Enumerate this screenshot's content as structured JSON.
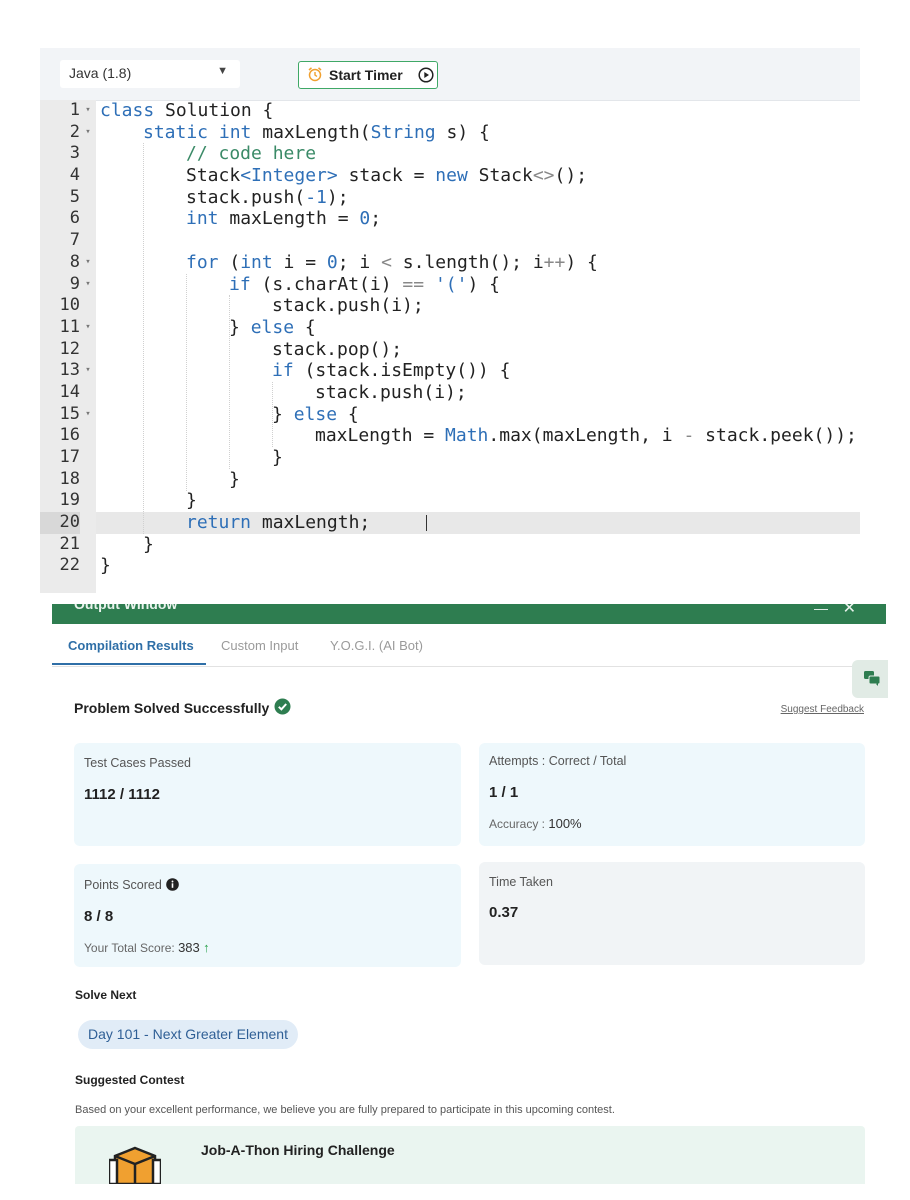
{
  "toolbar": {
    "language": "Java (1.8)",
    "timer_label": "Start Timer"
  },
  "editor": {
    "active_line": 20,
    "lines": [
      {
        "n": "1",
        "fold": true,
        "indent": 0,
        "tokens": [
          {
            "t": "class",
            "c": "kw"
          },
          {
            "t": " Solution {",
            "c": "pl"
          }
        ]
      },
      {
        "n": "2",
        "fold": true,
        "indent": 1,
        "tokens": [
          {
            "t": "static",
            "c": "kw"
          },
          {
            "t": " ",
            "c": "pl"
          },
          {
            "t": "int",
            "c": "kw"
          },
          {
            "t": " maxLength(",
            "c": "pl"
          },
          {
            "t": "String",
            "c": "kw"
          },
          {
            "t": " s) {",
            "c": "pl"
          }
        ]
      },
      {
        "n": "3",
        "fold": false,
        "indent": 2,
        "tokens": [
          {
            "t": "// code here",
            "c": "cm"
          }
        ]
      },
      {
        "n": "4",
        "fold": false,
        "indent": 2,
        "tokens": [
          {
            "t": "Stack",
            "c": "pl"
          },
          {
            "t": "<Integer>",
            "c": "kw"
          },
          {
            "t": " stack = ",
            "c": "pl"
          },
          {
            "t": "new",
            "c": "kw"
          },
          {
            "t": " Stack",
            "c": "pl"
          },
          {
            "t": "<>",
            "c": "op"
          },
          {
            "t": "();",
            "c": "pl"
          }
        ]
      },
      {
        "n": "5",
        "fold": false,
        "indent": 2,
        "tokens": [
          {
            "t": "stack.push(",
            "c": "pl"
          },
          {
            "t": "-1",
            "c": "num"
          },
          {
            "t": ");",
            "c": "pl"
          }
        ]
      },
      {
        "n": "6",
        "fold": false,
        "indent": 2,
        "tokens": [
          {
            "t": "int",
            "c": "kw"
          },
          {
            "t": " maxLength = ",
            "c": "pl"
          },
          {
            "t": "0",
            "c": "num"
          },
          {
            "t": ";",
            "c": "pl"
          }
        ]
      },
      {
        "n": "7",
        "fold": false,
        "indent": 0,
        "tokens": []
      },
      {
        "n": "8",
        "fold": true,
        "indent": 2,
        "tokens": [
          {
            "t": "for",
            "c": "kw"
          },
          {
            "t": " (",
            "c": "pl"
          },
          {
            "t": "int",
            "c": "kw"
          },
          {
            "t": " i = ",
            "c": "pl"
          },
          {
            "t": "0",
            "c": "num"
          },
          {
            "t": "; i ",
            "c": "pl"
          },
          {
            "t": "<",
            "c": "op"
          },
          {
            "t": " s.length(); i",
            "c": "pl"
          },
          {
            "t": "++",
            "c": "op"
          },
          {
            "t": ") {",
            "c": "pl"
          }
        ]
      },
      {
        "n": "9",
        "fold": true,
        "indent": 3,
        "tokens": [
          {
            "t": "if",
            "c": "kw"
          },
          {
            "t": " (s.charAt(i) ",
            "c": "pl"
          },
          {
            "t": "==",
            "c": "op"
          },
          {
            "t": " ",
            "c": "pl"
          },
          {
            "t": "'('",
            "c": "str"
          },
          {
            "t": ") {",
            "c": "pl"
          }
        ]
      },
      {
        "n": "10",
        "fold": false,
        "indent": 4,
        "tokens": [
          {
            "t": "stack.push(i);",
            "c": "pl"
          }
        ]
      },
      {
        "n": "11",
        "fold": true,
        "indent": 3,
        "tokens": [
          {
            "t": "} ",
            "c": "pl"
          },
          {
            "t": "else",
            "c": "kw"
          },
          {
            "t": " {",
            "c": "pl"
          }
        ]
      },
      {
        "n": "12",
        "fold": false,
        "indent": 4,
        "tokens": [
          {
            "t": "stack.pop();",
            "c": "pl"
          }
        ]
      },
      {
        "n": "13",
        "fold": true,
        "indent": 4,
        "tokens": [
          {
            "t": "if",
            "c": "kw"
          },
          {
            "t": " (stack.isEmpty()) {",
            "c": "pl"
          }
        ]
      },
      {
        "n": "14",
        "fold": false,
        "indent": 5,
        "tokens": [
          {
            "t": "stack.push(i);",
            "c": "pl"
          }
        ]
      },
      {
        "n": "15",
        "fold": true,
        "indent": 4,
        "tokens": [
          {
            "t": "} ",
            "c": "pl"
          },
          {
            "t": "else",
            "c": "kw"
          },
          {
            "t": " {",
            "c": "pl"
          }
        ]
      },
      {
        "n": "16",
        "fold": false,
        "indent": 5,
        "tokens": [
          {
            "t": "maxLength = ",
            "c": "pl"
          },
          {
            "t": "Math",
            "c": "kw"
          },
          {
            "t": ".max(maxLength, i ",
            "c": "pl"
          },
          {
            "t": "-",
            "c": "op"
          },
          {
            "t": " stack.peek());",
            "c": "pl"
          }
        ]
      },
      {
        "n": "17",
        "fold": false,
        "indent": 4,
        "tokens": [
          {
            "t": "}",
            "c": "pl"
          }
        ]
      },
      {
        "n": "18",
        "fold": false,
        "indent": 3,
        "tokens": [
          {
            "t": "}",
            "c": "pl"
          }
        ]
      },
      {
        "n": "19",
        "fold": false,
        "indent": 2,
        "tokens": [
          {
            "t": "}",
            "c": "pl"
          }
        ]
      },
      {
        "n": "20",
        "fold": false,
        "indent": 2,
        "tokens": [
          {
            "t": "return",
            "c": "kw"
          },
          {
            "t": " maxLength;",
            "c": "pl"
          }
        ]
      },
      {
        "n": "21",
        "fold": false,
        "indent": 1,
        "tokens": [
          {
            "t": "}",
            "c": "pl"
          }
        ]
      },
      {
        "n": "22",
        "fold": false,
        "indent": 0,
        "tokens": [
          {
            "t": "}",
            "c": "pl"
          }
        ]
      }
    ]
  },
  "syntax_colors": {
    "kw": "#2e6fb7",
    "pl": "#222222",
    "cm": "#3a8a67",
    "num": "#2e6fb7",
    "str": "#2e6fb7",
    "op": "#888888"
  },
  "output": {
    "header_title": "Output Window",
    "tabs": [
      "Compilation Results",
      "Custom Input",
      "Y.O.G.I. (AI Bot)"
    ],
    "status": "Problem Solved Successfully",
    "suggest_feedback": "Suggest Feedback",
    "test_cases": {
      "label": "Test Cases Passed",
      "value": "1112 / 1112"
    },
    "attempts": {
      "label": "Attempts : Correct / Total",
      "value": "1 / 1",
      "accuracy_label": "Accuracy :",
      "accuracy_value": "100%"
    },
    "points": {
      "label": "Points Scored",
      "value": "8 / 8",
      "total_label": "Your Total Score:",
      "total_value": "383"
    },
    "time": {
      "label": "Time Taken",
      "value": "0.37"
    },
    "solve_next": {
      "title": "Solve Next",
      "chip": "Day 101 - Next Greater Element"
    },
    "contest": {
      "title": "Suggested Contest",
      "desc": "Based on your excellent performance, we believe you are fully prepared to participate in this upcoming contest.",
      "name": "Job-A-Thon Hiring Challenge"
    }
  },
  "colors": {
    "accent_green": "#2e7d50",
    "tab_blue": "#2f6fa7",
    "success_check": "#2e7d50",
    "score_up": "#2ea34f"
  }
}
